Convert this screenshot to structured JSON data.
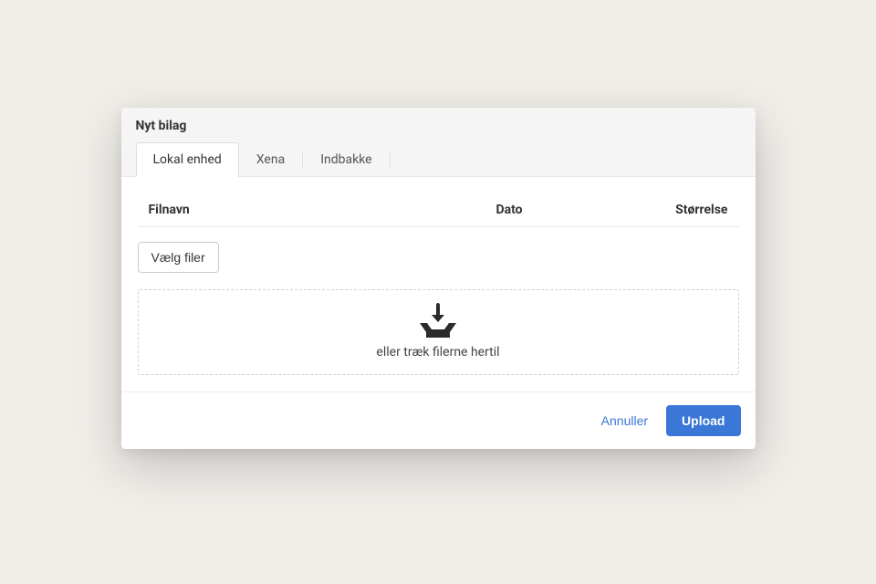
{
  "modal": {
    "title": "Nyt bilag",
    "tabs": [
      {
        "label": "Lokal enhed",
        "active": true
      },
      {
        "label": "Xena",
        "active": false
      },
      {
        "label": "Indbakke",
        "active": false
      }
    ],
    "columns": {
      "filename": "Filnavn",
      "date": "Dato",
      "size": "Størrelse"
    },
    "choose_files_label": "Vælg filer",
    "dropzone_text": "eller træk filerne hertil",
    "footer": {
      "cancel": "Annuller",
      "upload": "Upload"
    }
  }
}
